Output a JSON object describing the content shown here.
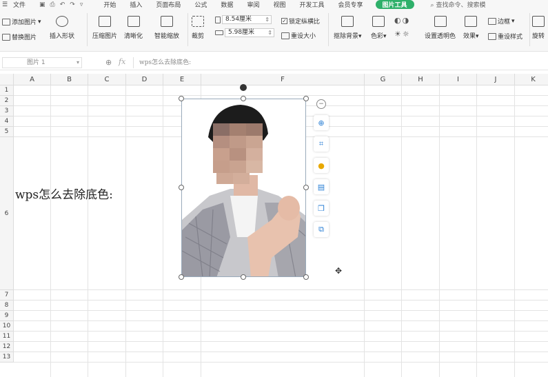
{
  "menubar": {
    "file": "文件",
    "tabs": [
      "开始",
      "插入",
      "页面布局",
      "公式",
      "数据",
      "审阅",
      "视图",
      "开发工具",
      "会员专享"
    ],
    "active_tab": "图片工具",
    "search": "查找命令、搜索模"
  },
  "ribbon": {
    "add_picture": "添加图片",
    "replace_picture": "替换图片",
    "insert_shape": "插入形状",
    "compress": "压缩图片",
    "clarity": "清晰化",
    "smart_zoom": "智能缩放",
    "crop": "裁剪",
    "height": "8.54厘米",
    "width": "5.98厘米",
    "lock_ratio": "锁定纵横比",
    "reset_size": "重设大小",
    "remove_bg": "抠除背景",
    "color": "色彩",
    "set_transparent": "设置透明色",
    "effects": "效果",
    "border": "边框",
    "reset_style": "重设样式",
    "rotate": "旋转"
  },
  "formula_bar": {
    "name_box": "图片 1",
    "fx": "fx",
    "content": "wps怎么去除底色:"
  },
  "sheet": {
    "columns": [
      "A",
      "B",
      "C",
      "D",
      "E",
      "F",
      "G",
      "H",
      "I",
      "J",
      "K"
    ],
    "rows": [
      "1",
      "2",
      "3",
      "4",
      "5",
      "6",
      "7",
      "8",
      "9",
      "10",
      "11",
      "12",
      "13"
    ],
    "cell_A6": "wps怎么去除底色:"
  },
  "colors": {
    "accent": "#2fb06a",
    "tool_blue": "#2a7fd4"
  }
}
